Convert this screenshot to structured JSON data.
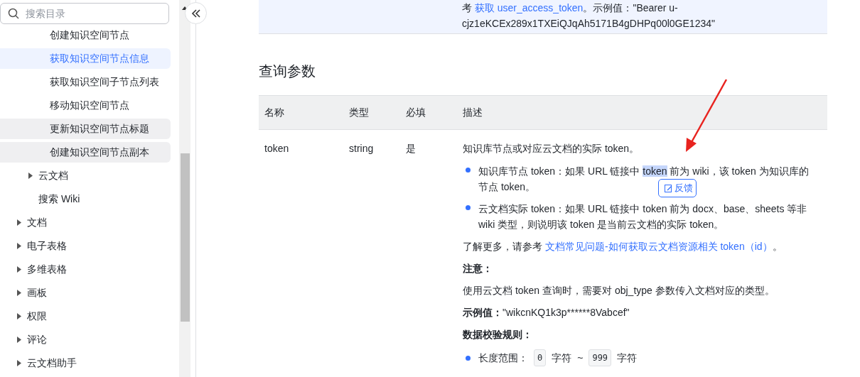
{
  "sidebar": {
    "search": {
      "placeholder": "搜索目录"
    },
    "items": [
      {
        "children": [
          {
            "children": [
              {
                "label": "创建知识空间节点",
                "selected": false,
                "shaded": false
              },
              {
                "label": "获取知识空间节点信息",
                "selected": true,
                "shaded": false
              },
              {
                "label": "获取知识空间子节点列表",
                "selected": false,
                "shaded": false
              },
              {
                "label": "移动知识空间节点",
                "selected": false,
                "shaded": false
              },
              {
                "label": "更新知识空间节点标题",
                "selected": false,
                "shaded": true
              },
              {
                "label": "创建知识空间节点副本",
                "selected": false,
                "shaded": true
              }
            ]
          },
          {
            "label": "云文档",
            "expanded": false,
            "selected": false,
            "shaded": false
          },
          {
            "label": "搜索 Wiki",
            "selected": false,
            "shaded": false
          }
        ]
      },
      {
        "label": "文档",
        "expanded": false,
        "selected": false,
        "shaded": false
      },
      {
        "label": "电子表格",
        "expanded": false,
        "selected": false,
        "shaded": false
      },
      {
        "label": "多维表格",
        "expanded": false,
        "selected": false,
        "shaded": false
      },
      {
        "label": "画板",
        "expanded": false,
        "selected": false,
        "shaded": false
      },
      {
        "label": "权限",
        "expanded": false,
        "selected": false,
        "shaded": false
      },
      {
        "label": "评论",
        "expanded": false,
        "selected": false,
        "shaded": false
      },
      {
        "label": "云文档助手",
        "expanded": false,
        "selected": false,
        "shaded": false
      }
    ]
  },
  "note": {
    "before": "考 ",
    "link": "获取 user_access_token",
    "after": "。示例值：\"Bearer u-cjz1eKCEx289x1TXEiQJqAh5171B4gDHPq00l0GE1234\""
  },
  "section_title": "查询参数",
  "table": {
    "columns": [
      "名称",
      "类型",
      "必填",
      "描述"
    ],
    "rows": [
      {
        "name": "token",
        "type": "string",
        "required": "是",
        "description": {
          "intro": "知识库节点或对应云文档的实际 token。",
          "bullets": [
            [
              {
                "text": "知识库节点 token：如果 URL 链接中 ",
                "highlighted": false
              },
              {
                "text": "token",
                "highlighted": true
              },
              {
                "text": " 前为 wiki，该 token 为知识库的节点 token。",
                "highlighted": false
              }
            ],
            [
              {
                "text": "云文档实际 token：如果 URL 链接中 token 前为 docx、base、sheets 等非 wiki 类型，则说明该 token 是当前云文档的实际 token。",
                "highlighted": false
              }
            ]
          ],
          "more": {
            "before": "了解更多，请参考 ",
            "link": "文档常见问题-如何获取云文档资源相关 token（id）",
            "after": "。"
          },
          "notice_label": "注意：",
          "notice": "使用云文档 token 查询时，需要对 obj_type 参数传入文档对应的类型。",
          "example_label": "示例值：",
          "example": "\"wikcnKQ1k3p******8Vabcef\"",
          "rules_label": "数据校验规则：",
          "rule": {
            "label": "长度范围：",
            "min": "0",
            "min_unit": "字符",
            "sep": "~",
            "max": "999",
            "max_unit": "字符"
          }
        }
      }
    ]
  },
  "feedback_button": "反馈"
}
